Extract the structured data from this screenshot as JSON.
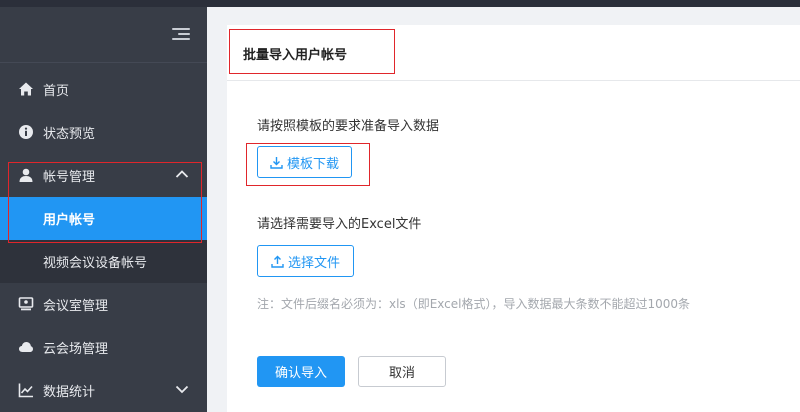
{
  "sidebar": {
    "items": [
      {
        "label": "首页",
        "icon": "home-icon"
      },
      {
        "label": "状态预览",
        "icon": "info-icon"
      },
      {
        "label": "帐号管理",
        "icon": "user-icon",
        "expanded": true
      },
      {
        "label": "用户帐号",
        "active": true
      },
      {
        "label": "视频会议设备帐号"
      },
      {
        "label": "会议室管理",
        "icon": "meeting-room-icon"
      },
      {
        "label": "云会场管理",
        "icon": "cloud-icon"
      },
      {
        "label": "数据统计",
        "icon": "chart-icon",
        "expanded": false
      }
    ]
  },
  "main": {
    "title": "批量导入用户帐号",
    "step1_text": "请按照模板的要求准备导入数据",
    "download_label": "模板下载",
    "step2_text": "请选择需要导入的Excel文件",
    "choose_label": "选择文件",
    "note": "注：文件后缀名必须为：xls（即Excel格式），导入数据最大条数不能超过1000条",
    "confirm_label": "确认导入",
    "cancel_label": "取消"
  },
  "colors": {
    "sidebar_bg": "#383d47",
    "accent": "#2196f3",
    "highlight": "#e0262b"
  }
}
